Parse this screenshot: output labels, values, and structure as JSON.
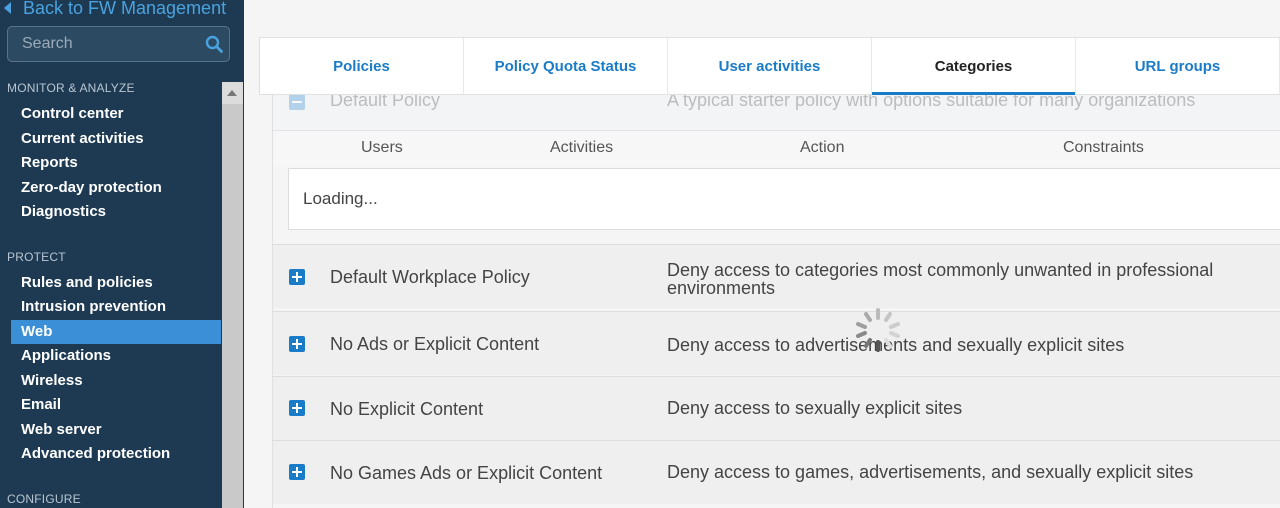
{
  "sidebar": {
    "back_label": "Back to FW Management",
    "search_placeholder": "Search",
    "sections": [
      {
        "title": "MONITOR & ANALYZE",
        "items": [
          "Control center",
          "Current activities",
          "Reports",
          "Zero-day protection",
          "Diagnostics"
        ]
      },
      {
        "title": "PROTECT",
        "items": [
          "Rules and policies",
          "Intrusion prevention",
          "Web",
          "Applications",
          "Wireless",
          "Email",
          "Web server",
          "Advanced protection"
        ]
      },
      {
        "title": "CONFIGURE",
        "items": []
      }
    ],
    "active_item": "Web"
  },
  "tabs": [
    {
      "label": "Policies",
      "active": false
    },
    {
      "label": "Policy Quota Status",
      "active": false
    },
    {
      "label": "User activities",
      "active": false
    },
    {
      "label": "Categories",
      "active": true
    },
    {
      "label": "URL groups",
      "active": false
    }
  ],
  "expanded_policy": {
    "name": "Default Policy",
    "description": "A typical starter policy with options suitable for many organizations",
    "columns": [
      "Users",
      "Activities",
      "Action",
      "Constraints"
    ],
    "loading_text": "Loading..."
  },
  "policies": [
    {
      "name": "Default Workplace Policy",
      "description_line1": "Deny access to categories most commonly unwanted in professional",
      "description_line2": "environments"
    },
    {
      "name": "No Ads or Explicit Content",
      "description_line1": "Deny access to advertisements and sexually explicit sites",
      "description_line2": ""
    },
    {
      "name": "No Explicit Content",
      "description_line1": "Deny access to sexually explicit sites",
      "description_line2": ""
    },
    {
      "name": "No Games Ads or Explicit Content",
      "description_line1": "Deny access to games, advertisements, and sexually explicit sites",
      "description_line2": ""
    }
  ],
  "colors": {
    "sidebar_bg": "#1d3a52",
    "accent": "#1a7cc7",
    "active_nav": "#3b8fd6"
  }
}
